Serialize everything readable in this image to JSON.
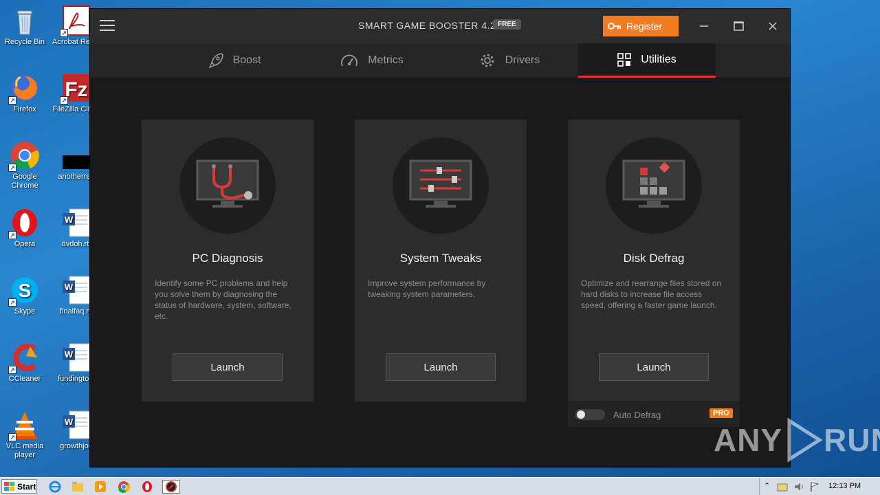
{
  "desktop": {
    "icons": [
      {
        "label": "Recycle Bin"
      },
      {
        "label": "Acrobat Reader DC"
      },
      {
        "label": "Firefox"
      },
      {
        "label": "FileZilla Client"
      },
      {
        "label": "Google Chrome"
      },
      {
        "label": "anotherred"
      },
      {
        "label": "Opera"
      },
      {
        "label": "dvdoh.rtf"
      },
      {
        "label": "Skype"
      },
      {
        "label": "finalfaq.rtf"
      },
      {
        "label": "CCleaner"
      },
      {
        "label": "fundingtool"
      },
      {
        "label": "VLC media player"
      },
      {
        "label": "growthjou"
      }
    ]
  },
  "app": {
    "title": "SMART GAME BOOSTER 4.2",
    "badge": "FREE",
    "register_label": "Register",
    "tabs": [
      {
        "label": "Boost",
        "icon": "rocket-icon"
      },
      {
        "label": "Metrics",
        "icon": "gauge-icon"
      },
      {
        "label": "Drivers",
        "icon": "gear-icon"
      },
      {
        "label": "Utilities",
        "icon": "grid-icon",
        "active": true
      }
    ],
    "cards": [
      {
        "title": "PC Diagnosis",
        "description": "Identify some PC problems and help you solve them by diagnosing the status of hardware, system, software, etc.",
        "button": "Launch"
      },
      {
        "title": "System Tweaks",
        "description": "Improve system performance by tweaking system parameters.",
        "button": "Launch"
      },
      {
        "title": "Disk Defrag",
        "description": "Optimize and rearrange files stored on hard disks to increase file access speed, offering a faster game launch.",
        "button": "Launch"
      }
    ],
    "auto_defrag": {
      "label": "Auto Defrag",
      "enabled": false,
      "badge": "PRO"
    }
  },
  "taskbar": {
    "start_label": "Start",
    "clock": "12:13 PM"
  },
  "watermark": {
    "text_left": "ANY",
    "text_right": "RUN"
  },
  "colors": {
    "accent": "#f27c1f",
    "active_tab_underline": "#e4332f",
    "card_bg": "#2c2c2c"
  }
}
